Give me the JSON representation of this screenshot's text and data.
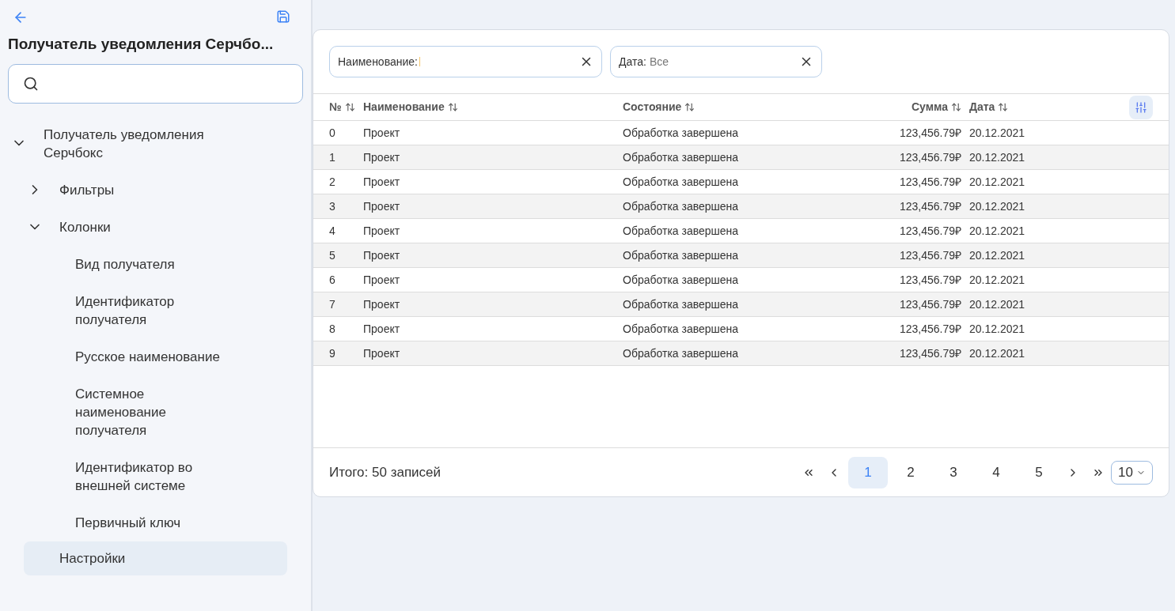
{
  "sidebar": {
    "title": "Получатель уведомления Серчбо...",
    "tree": [
      {
        "label": "Получатель уведомления Серчбокс",
        "expanded": true,
        "selected": false,
        "children": [
          {
            "label": "Фильтры",
            "expanded": false,
            "selected": false
          },
          {
            "label": "Колонки",
            "expanded": true,
            "selected": false,
            "children": [
              {
                "label": "Вид получателя",
                "selected": false
              },
              {
                "label": "Идентификатор получателя",
                "selected": false
              },
              {
                "label": "Русское наименование",
                "selected": false
              },
              {
                "label": "Системное наименование получателя",
                "selected": false
              },
              {
                "label": "Идентификатор во внешней системе",
                "selected": false
              },
              {
                "label": "Первичный ключ",
                "selected": false
              }
            ]
          },
          {
            "label": "Настройки",
            "selected": true
          }
        ]
      }
    ]
  },
  "filters": [
    {
      "label": "Наименование:"
    },
    {
      "label": "Дата:",
      "value": "Все"
    }
  ],
  "table": {
    "columns": [
      "№",
      "Наименование",
      "Состояние",
      "Сумма",
      "Дата"
    ],
    "rows": [
      [
        "0",
        "Проект",
        "Обработка завершена",
        "123,456.79₽",
        "20.12.2021"
      ],
      [
        "1",
        "Проект",
        "Обработка завершена",
        "123,456.79₽",
        "20.12.2021"
      ],
      [
        "2",
        "Проект",
        "Обработка завершена",
        "123,456.79₽",
        "20.12.2021"
      ],
      [
        "3",
        "Проект",
        "Обработка завершена",
        "123,456.79₽",
        "20.12.2021"
      ],
      [
        "4",
        "Проект",
        "Обработка завершена",
        "123,456.79₽",
        "20.12.2021"
      ],
      [
        "5",
        "Проект",
        "Обработка завершена",
        "123,456.79₽",
        "20.12.2021"
      ],
      [
        "6",
        "Проект",
        "Обработка завершена",
        "123,456.79₽",
        "20.12.2021"
      ],
      [
        "7",
        "Проект",
        "Обработка завершена",
        "123,456.79₽",
        "20.12.2021"
      ],
      [
        "8",
        "Проект",
        "Обработка завершена",
        "123,456.79₽",
        "20.12.2021"
      ],
      [
        "9",
        "Проект",
        "Обработка завершена",
        "123,456.79₽",
        "20.12.2021"
      ]
    ]
  },
  "footer": {
    "total": "Итого: 50 записей",
    "pages": [
      {
        "label": "1",
        "selected": true
      },
      {
        "label": "2",
        "selected": false
      },
      {
        "label": "3",
        "selected": false
      },
      {
        "label": "4",
        "selected": false
      },
      {
        "label": "5",
        "selected": false
      }
    ],
    "page_size": "10"
  }
}
